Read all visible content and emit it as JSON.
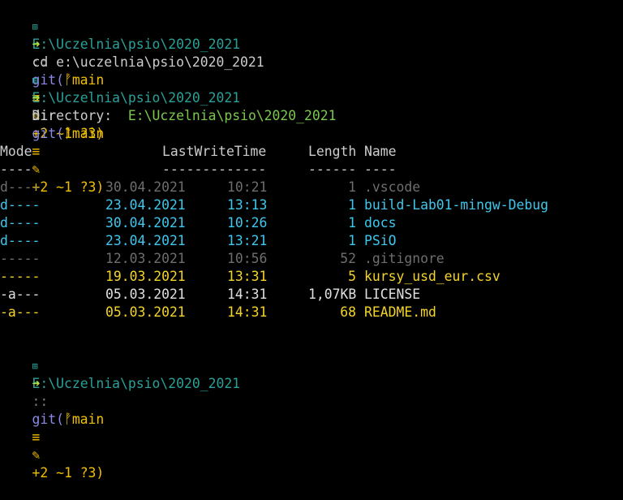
{
  "prompt": {
    "path": "E:\\Uczelnia\\psio\\2020_2021",
    "separator": "::",
    "git_open": "git(",
    "branch": "main",
    "status_eq": "≡",
    "status_changes": "+2 ~1 ?3)",
    "arrow": "➜"
  },
  "commands": [
    "cd e:\\uczelnia\\psio\\2020_2021",
    "dir"
  ],
  "listing": {
    "label": "Directory:",
    "path": "E:\\Uczelnia\\psio\\2020_2021",
    "headers": {
      "mode": "Mode",
      "time": "LastWriteTime",
      "length": "Length",
      "name": "Name"
    },
    "underlines": {
      "mode": "----",
      "time": "-------------",
      "length": "------",
      "name": "----"
    },
    "rows": [
      {
        "mode": "d----",
        "date": "30.04.2021",
        "time": "10:21",
        "length": "1",
        "name": ".vscode",
        "style": "gray"
      },
      {
        "mode": "d----",
        "date": "23.04.2021",
        "time": "13:13",
        "length": "1",
        "name": "build-Lab01-mingw-Debug",
        "style": "cyan"
      },
      {
        "mode": "d----",
        "date": "30.04.2021",
        "time": "10:26",
        "length": "1",
        "name": "docs",
        "style": "cyan"
      },
      {
        "mode": "d----",
        "date": "23.04.2021",
        "time": "13:21",
        "length": "1",
        "name": "PSiO",
        "style": "cyan"
      },
      {
        "mode": "-----",
        "date": "12.03.2021",
        "time": "10:56",
        "length": "52",
        "name": ".gitignore",
        "style": "gray"
      },
      {
        "mode": "-----",
        "date": "19.03.2021",
        "time": "13:31",
        "length": "5",
        "name": "kursy_usd_eur.csv",
        "style": "yellow"
      },
      {
        "mode": "-a---",
        "date": "05.03.2021",
        "time": "14:31",
        "length": "1,07KB",
        "name": "LICENSE",
        "style": "white"
      },
      {
        "mode": "-a---",
        "date": "05.03.2021",
        "time": "14:31",
        "length": "68",
        "name": "README.md",
        "style": "yellow"
      }
    ]
  },
  "colors": {
    "background": "#000000",
    "path": "#2aa198",
    "branch": "#f0c000",
    "arrow": "#b8e03a",
    "dir_path": "#7ac94d",
    "cyan": "#3ec8ee",
    "yellow": "#f5d428",
    "gray": "#6e6e6e"
  },
  "icons": {
    "windows": "windows-icon",
    "branch": "git-branch-icon",
    "edit": "edit-icon"
  }
}
